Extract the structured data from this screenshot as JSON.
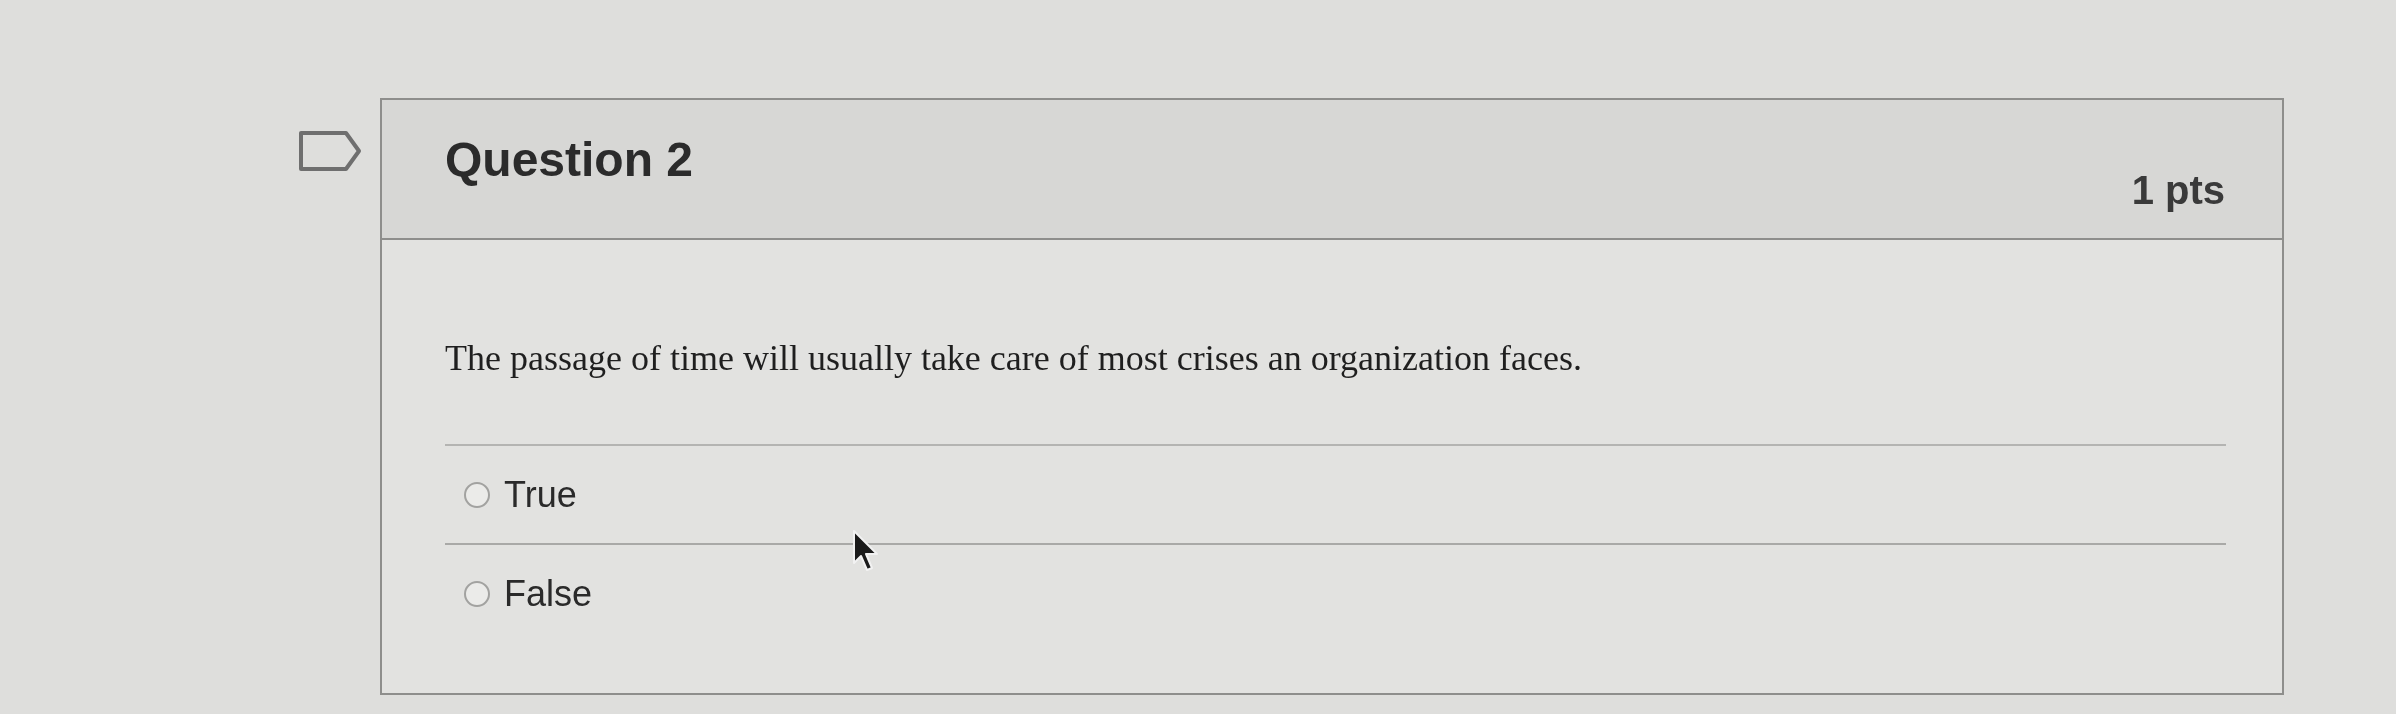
{
  "question": {
    "flagged": false,
    "title": "Question 2",
    "points": "1 pts",
    "text": "The passage of time will usually take care of most crises an organization faces.",
    "answers": [
      {
        "label": "True",
        "selected": false
      },
      {
        "label": "False",
        "selected": false
      }
    ]
  }
}
